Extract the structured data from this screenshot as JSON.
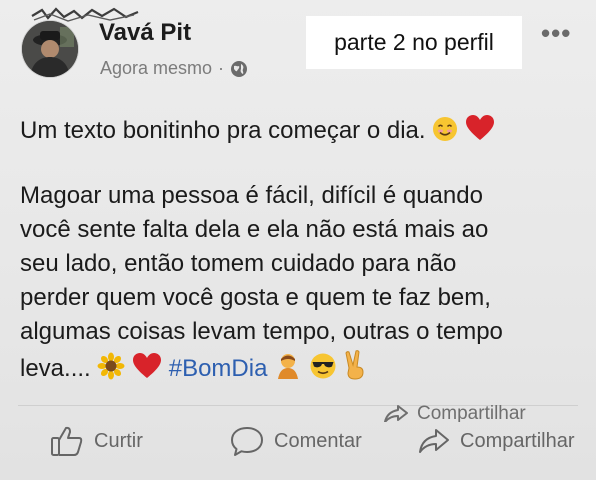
{
  "post": {
    "author": "Vavá Pit",
    "time": "Agora mesmo",
    "separator": "·",
    "privacy_icon": "globe-icon",
    "overlay_tag": "parte 2 no perfil",
    "more_icon": "more-options-icon",
    "greeting": "Um texto bonitinho pra começar o dia.",
    "body_lines": [
      "Magoar uma pessoa é fácil, difícil é quando",
      "você sente falta dela e ela não está mais ao",
      "seu lado, então tomem cuidado para não",
      "perder quem você gosta e quem te faz bem,",
      "algumas coisas levam tempo, outras o tempo"
    ],
    "last_line_text": "leva....",
    "hashtag": "#BomDia"
  },
  "actions": {
    "like_label": "Curtir",
    "comment_label": "Comentar",
    "share_label": "Compartilhar",
    "share_ghost_label": "Compartilhar"
  },
  "colors": {
    "background": "#e9e9e9",
    "hashtag": "#2d5fb0",
    "heart": "#d8232a",
    "action_text": "#666666"
  }
}
